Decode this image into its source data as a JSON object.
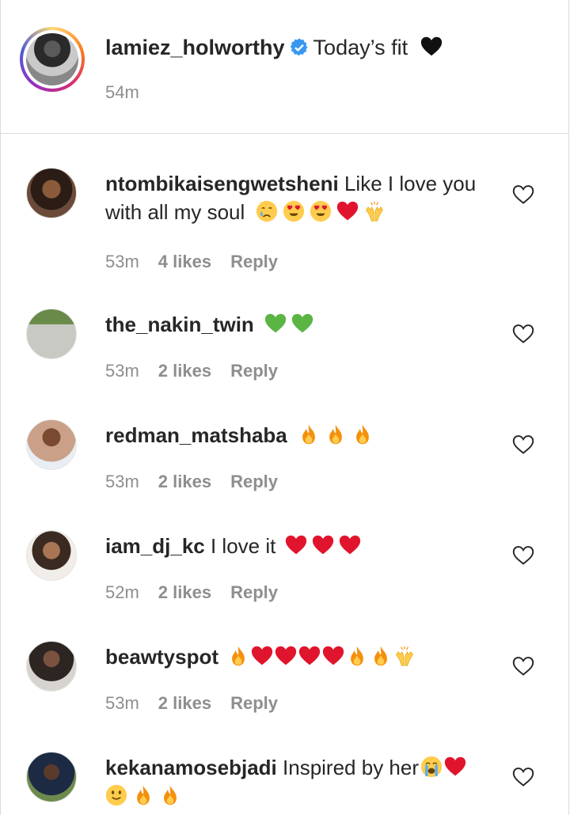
{
  "post": {
    "username": "lamiez_holworthy",
    "caption": "Today’s fit",
    "caption_emojis": [
      "black-heart-icon"
    ],
    "time": "54m"
  },
  "comments": [
    {
      "username": "ntombikaisengwetsheni",
      "text_line1": "Like I love you",
      "text_line2": "with all my soul",
      "emojis": [
        "crying-face-icon",
        "heart-eyes-icon",
        "heart-eyes-icon",
        "red-heart-icon",
        "raising-hands-icon"
      ],
      "time": "53m",
      "likes": "4 likes",
      "reply": "Reply"
    },
    {
      "username": "the_nakin_twin",
      "text": "",
      "emojis": [
        "green-heart-icon",
        "green-heart-icon"
      ],
      "time": "53m",
      "likes": "2 likes",
      "reply": "Reply"
    },
    {
      "username": "redman_matshaba",
      "text": "",
      "emojis": [
        "fire-icon",
        "fire-icon",
        "fire-icon"
      ],
      "time": "53m",
      "likes": "2 likes",
      "reply": "Reply"
    },
    {
      "username": "iam_dj_kc",
      "text": "I love it",
      "emojis": [
        "red-heart-icon",
        "red-heart-icon",
        "red-heart-icon"
      ],
      "time": "52m",
      "likes": "2 likes",
      "reply": "Reply"
    },
    {
      "username": "beawtyspot",
      "text": "",
      "emojis": [
        "fire-icon",
        "red-heart-icon",
        "red-heart-icon",
        "red-heart-icon",
        "red-heart-icon",
        "fire-icon",
        "fire-icon",
        "raising-hands-icon"
      ],
      "time": "53m",
      "likes": "2 likes",
      "reply": "Reply"
    },
    {
      "username": "kekanamosebjadi",
      "text": "Inspired by her",
      "emojis_inline": [
        "loudly-crying-icon",
        "red-heart-icon"
      ],
      "emojis_line2": [
        "slight-smile-icon",
        "fire-icon",
        "fire-icon"
      ]
    }
  ],
  "colors": {
    "text": "#262626",
    "secondary": "#8e8e8e",
    "verified": "#3897f0",
    "divider": "#dbdbdb"
  }
}
